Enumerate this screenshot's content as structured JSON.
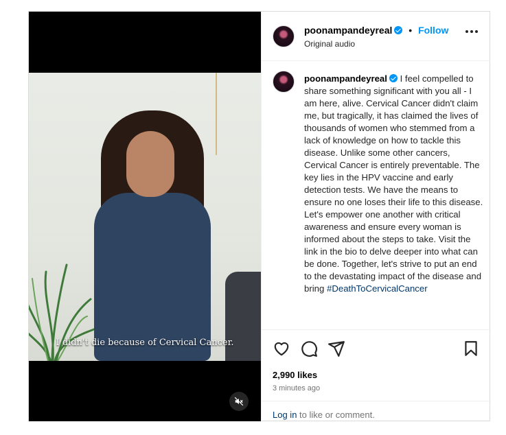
{
  "video": {
    "subtitle": "I didn't die because of Cervical Cancer."
  },
  "header": {
    "username": "poonampandeyreal",
    "separator": "•",
    "follow_label": "Follow",
    "audio": "Original audio"
  },
  "caption": {
    "username": "poonampandeyreal",
    "text": " I feel compelled to share something significant with you all - I am here, alive. Cervical Cancer didn't claim me, but tragically, it has claimed the lives of thousands of women who stemmed from a lack of knowledge on how to tackle this disease. Unlike some other cancers, Cervical Cancer is entirely preventable. The key lies in the HPV vaccine and early detection tests. We have the means to ensure no one loses their life to this disease. Let's empower one another with critical awareness and ensure every woman is informed about the steps to take. Visit the link in the bio to delve deeper into what can be done. Together, let's strive to put an end to the devastating impact of the disease and bring ",
    "hashtag": "#DeathToCervicalCancer"
  },
  "stats": {
    "likes": "2,990 likes",
    "time": "3 minutes ago"
  },
  "login": {
    "link": "Log in",
    "rest": " to like or comment."
  },
  "colors": {
    "accent": "#0095f6",
    "link": "#00376b",
    "muted": "#737373"
  },
  "icons": [
    "heart-icon",
    "comment-icon",
    "share-icon",
    "bookmark-icon",
    "mute-icon",
    "more-icon",
    "verified-icon"
  ]
}
